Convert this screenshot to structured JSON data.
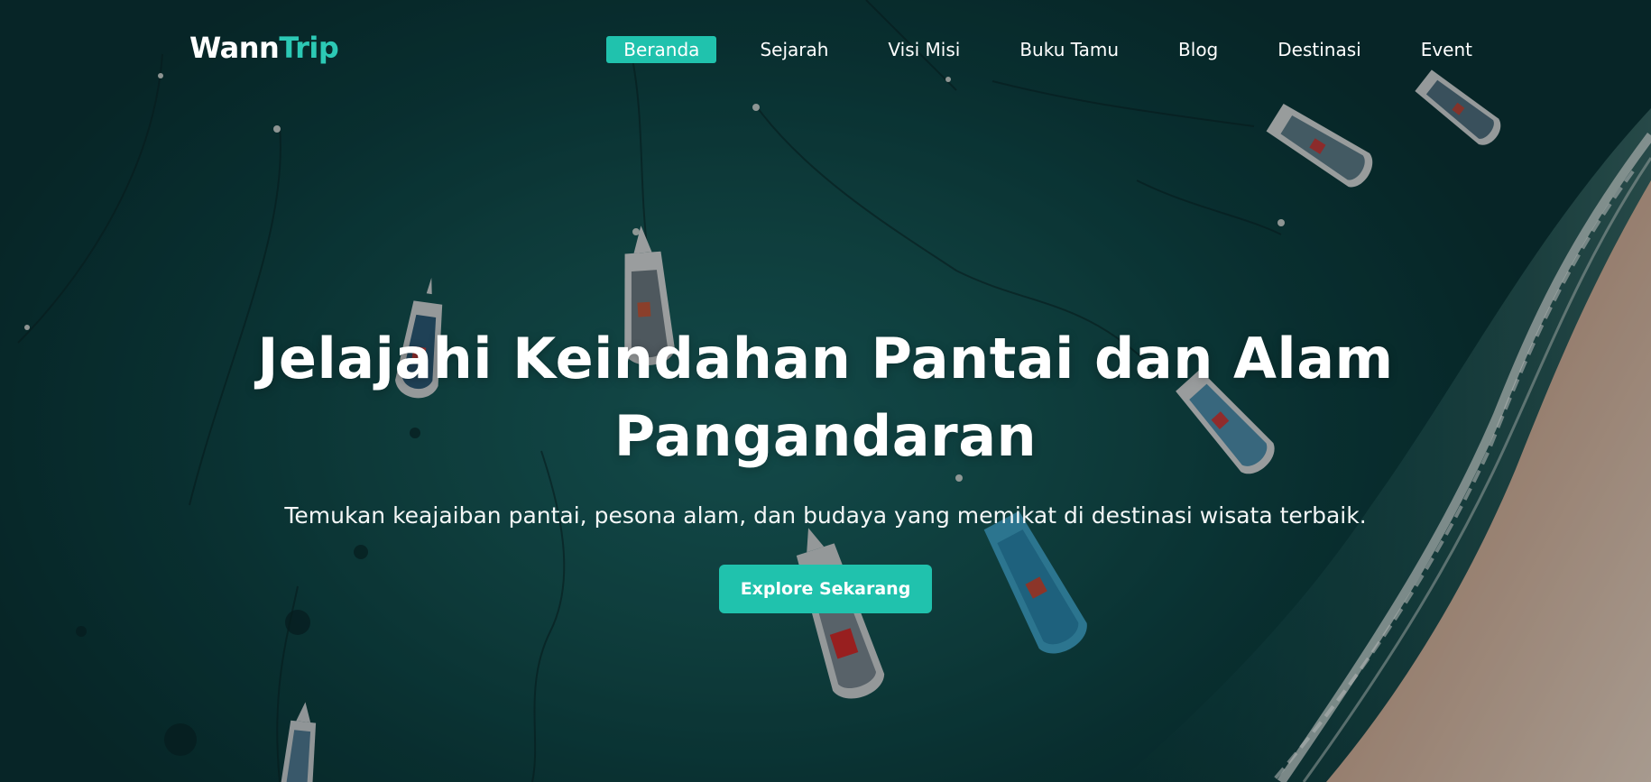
{
  "brand": {
    "name_part1": "Wann",
    "name_part2": "Trip"
  },
  "nav": {
    "items": [
      {
        "label": "Beranda",
        "active": true
      },
      {
        "label": "Sejarah",
        "active": false
      },
      {
        "label": "Visi Misi",
        "active": false
      },
      {
        "label": "Buku Tamu",
        "active": false
      },
      {
        "label": "Blog",
        "active": false
      },
      {
        "label": "Destinasi",
        "active": false
      },
      {
        "label": "Event",
        "active": false
      }
    ]
  },
  "hero": {
    "title_line1": "Jelajahi Keindahan Pantai dan Alam",
    "title_line2": "Pangandaran",
    "subtitle": "Temukan keajaiban pantai, pesona alam, dan budaya yang memikat di destinasi wisata terbaik.",
    "cta_label": "Explore Sekarang"
  },
  "colors": {
    "accent": "#20c2ad",
    "brand_accent": "#2cc9b5",
    "sea_dark": "#0a3436",
    "sea_light": "#1b6766",
    "sand": "#c9a68f"
  }
}
